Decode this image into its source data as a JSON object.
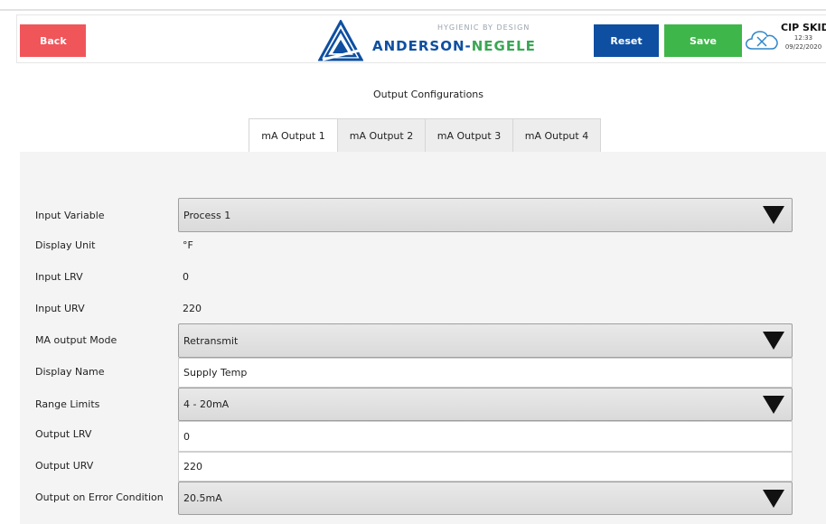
{
  "header": {
    "back_label": "Back",
    "reset_label": "Reset",
    "save_label": "Save",
    "logo_tagline": "HYGIENIC BY DESIGN",
    "logo_name_part1": "ANDERSON-",
    "logo_name_part2": "NEGELE",
    "station_name": "CIP SKID",
    "time": "12:33",
    "date": "09/22/2020"
  },
  "page_title": "Output Configurations",
  "tabs": [
    {
      "label": "mA Output 1",
      "active": true
    },
    {
      "label": "mA Output 2",
      "active": false
    },
    {
      "label": "mA Output 3",
      "active": false
    },
    {
      "label": "mA Output 4",
      "active": false
    }
  ],
  "form": {
    "input_variable": {
      "label": "Input Variable",
      "value": "Process 1"
    },
    "display_unit": {
      "label": "Display Unit",
      "value": "°F"
    },
    "input_lrv": {
      "label": "Input LRV",
      "value": "0"
    },
    "input_urv": {
      "label": "Input URV",
      "value": "220"
    },
    "ma_output_mode": {
      "label": "MA output Mode",
      "value": "Retransmit"
    },
    "display_name": {
      "label": "Display Name",
      "value": "Supply Temp"
    },
    "range_limits": {
      "label": "Range Limits",
      "value": "4 - 20mA"
    },
    "output_lrv": {
      "label": "Output LRV",
      "value": "0"
    },
    "output_urv": {
      "label": "Output URV",
      "value": "220"
    },
    "output_on_error": {
      "label": "Output on Error Condition",
      "value": "20.5mA"
    }
  },
  "colors": {
    "back": "#f0555a",
    "reset": "#0e4fa1",
    "save": "#3fb64a",
    "brand_blue": "#0e4fa1",
    "brand_green": "#3aa655"
  }
}
